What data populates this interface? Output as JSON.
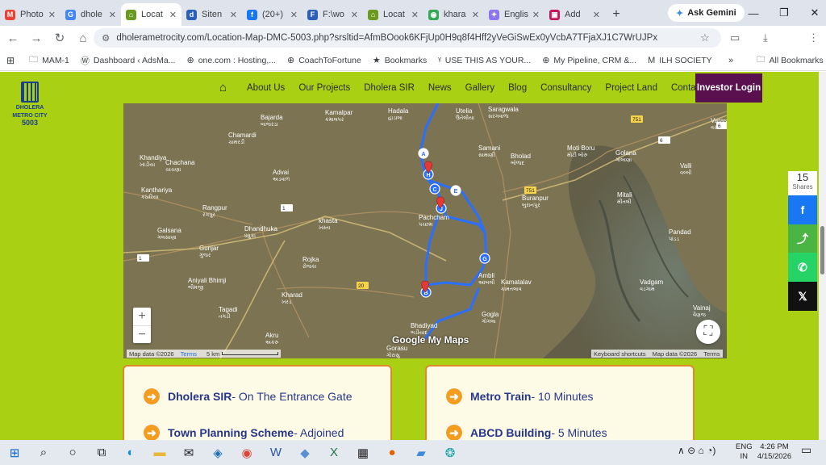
{
  "browser": {
    "tabs": [
      {
        "label": "Photo",
        "icon": "gmail-icon",
        "color": "#ea4335",
        "glyph": "M"
      },
      {
        "label": "dhole",
        "icon": "google-icon",
        "color": "#4285f4",
        "glyph": "G"
      },
      {
        "label": "Locat",
        "icon": "site-icon",
        "color": "#6a9a1f",
        "glyph": "⌂",
        "active": true
      },
      {
        "label": "Siten",
        "icon": "d-icon",
        "color": "#2b5fb8",
        "glyph": "d"
      },
      {
        "label": "(20+)",
        "icon": "facebook-icon",
        "color": "#1877f2",
        "glyph": "f"
      },
      {
        "label": "F:\\wo",
        "icon": "d-icon",
        "color": "#2b5fb8",
        "glyph": "F"
      },
      {
        "label": "Locat",
        "icon": "site-icon",
        "color": "#6a9a1f",
        "glyph": "⌂"
      },
      {
        "label": "khara",
        "icon": "maps-icon",
        "color": "#34a853",
        "glyph": "◉"
      },
      {
        "label": "Englis",
        "icon": "gemini-icon",
        "color": "#8e75f0",
        "glyph": "✦"
      },
      {
        "label": "Add",
        "icon": "add-icon",
        "color": "#c2185b",
        "glyph": "▣"
      }
    ],
    "ask_gemini": "Ask Gemini",
    "url": "dholerametrocity.com/Location-Map-DMC-5003.php?srsltid=AfmBOook6KFjUp0H9q8f4Hff2yVeGiSwEx0yVcbA7TFjaXJ1C7WrUJPx",
    "bookmarks": [
      {
        "label": "MAM-1",
        "icon": "folder-icon",
        "glyph": "🗀"
      },
      {
        "label": "Dashboard ‹ AdsMa...",
        "icon": "wordpress-icon",
        "glyph": "Ⓦ"
      },
      {
        "label": "one.com : Hosting,...",
        "icon": "globe-icon",
        "glyph": "⊕"
      },
      {
        "label": "CoachToFortune",
        "icon": "globe-icon",
        "glyph": "⊕"
      },
      {
        "label": "Bookmarks",
        "icon": "star-icon",
        "glyph": "★"
      },
      {
        "label": "USE THIS AS YOUR...",
        "icon": "bookmark-icon",
        "glyph": "ᵞ"
      },
      {
        "label": "My Pipeline, CRM &...",
        "icon": "globe-icon",
        "glyph": "⊕"
      },
      {
        "label": "ILH SOCIETY",
        "icon": "ilh-icon",
        "glyph": "M"
      }
    ],
    "all_bookmarks": "All Bookmarks"
  },
  "site": {
    "logo_lines": [
      "DHOLERA",
      "METRO CITY",
      "5003"
    ],
    "menu": [
      "About Us",
      "Our Projects",
      "Dholera SIR",
      "News",
      "Gallery",
      "Blog",
      "Consultancy",
      "Project Land",
      "Contact Us"
    ],
    "investor_login": "Investor Login"
  },
  "map": {
    "places": [
      {
        "name": "Kamalpar",
        "guj": "કમાલપર"
      },
      {
        "name": "Bajarda",
        "guj": "બાજરડા"
      },
      {
        "name": "Chamardi",
        "guj": "ચામરડી"
      },
      {
        "name": "Khandiya",
        "guj": "ખાંડીયા"
      },
      {
        "name": "Chachana",
        "guj": "ચાચણા"
      },
      {
        "name": "Advai",
        "guj": "અડવાળ"
      },
      {
        "name": "Kanthariya",
        "guj": "કંઠારિયા"
      },
      {
        "name": "Rangpur",
        "guj": "રંગપુર"
      },
      {
        "name": "Galsana",
        "guj": "ગલસાણા"
      },
      {
        "name": "Dhandhuka",
        "guj": "ધંધુકા"
      },
      {
        "name": "khasta",
        "guj": "ખસ્તા"
      },
      {
        "name": "Gunjar",
        "guj": "ગુંજર"
      },
      {
        "name": "Rojka",
        "guj": "રોજકા"
      },
      {
        "name": "Aniyali Bhimji",
        "guj": "ભીમજી"
      },
      {
        "name": "Kharad",
        "guj": "ખરડ"
      },
      {
        "name": "Tagadi",
        "guj": "તગડી"
      },
      {
        "name": "Akru",
        "guj": "અકરુ"
      },
      {
        "name": "Gorasu",
        "guj": "ગોરાસુ"
      },
      {
        "name": "Bhadiyad",
        "guj": "ભડીયાદ"
      },
      {
        "name": "Hadala",
        "guj": "હાડાલા"
      },
      {
        "name": "Utelia",
        "guj": "ઉતેલીયા"
      },
      {
        "name": "Saragwala",
        "guj": "સરગવાળા"
      },
      {
        "name": "Samani",
        "guj": "સામાણી"
      },
      {
        "name": "Bholad",
        "guj": "ભોળાદ"
      },
      {
        "name": "Buranpur",
        "guj": "બુરાનપુર"
      },
      {
        "name": "Kamatalav",
        "guj": "કામતલાવ"
      },
      {
        "name": "Gogla",
        "guj": "ગોગલા"
      },
      {
        "name": "Moti Boru",
        "guj": "મોટી બોરુ"
      },
      {
        "name": "Golana",
        "guj": "ગોલાણા"
      },
      {
        "name": "Valli",
        "guj": "વલ્લી"
      },
      {
        "name": "Mitali",
        "guj": "મીતલી"
      },
      {
        "name": "Pandad",
        "guj": "પાંડડ"
      },
      {
        "name": "Vadgam",
        "guj": "વડગામ"
      },
      {
        "name": "Vainaj",
        "guj": "વૈણજ"
      },
      {
        "name": "Varas",
        "guj": "વરસ"
      },
      {
        "name": "Pachcham",
        "guj": "પચ્છમ"
      },
      {
        "name": "Ambli",
        "guj": "આંબલી"
      }
    ],
    "markers": [
      "A",
      "H",
      "C",
      "J",
      "E",
      "G",
      "B"
    ],
    "road_numbers": [
      "751",
      "751",
      "1",
      "1",
      "20",
      "6",
      "6"
    ],
    "watermark": "Google My Maps",
    "footer_left": "Map data ©2026",
    "footer_terms": "Terms",
    "footer_scale": "5 km",
    "footer_right": [
      "Keyboard shortcuts",
      "Map data ©2026",
      "Terms"
    ]
  },
  "cards": {
    "left": [
      {
        "bold": "Dholera SIR",
        "rest": "- On The Entrance Gate"
      },
      {
        "bold": "Town Planning Scheme",
        "rest": "- Adjoined"
      }
    ],
    "right": [
      {
        "bold": "Metro Train",
        "rest": "- 10 Minutes"
      },
      {
        "bold": "ABCD Building",
        "rest": "- 5 Minutes"
      }
    ]
  },
  "share": {
    "count": "15",
    "label": "Shares"
  },
  "taskbar": {
    "lang": [
      "ENG",
      "IN"
    ],
    "time": "4:26 PM",
    "date": "4/15/2026"
  }
}
